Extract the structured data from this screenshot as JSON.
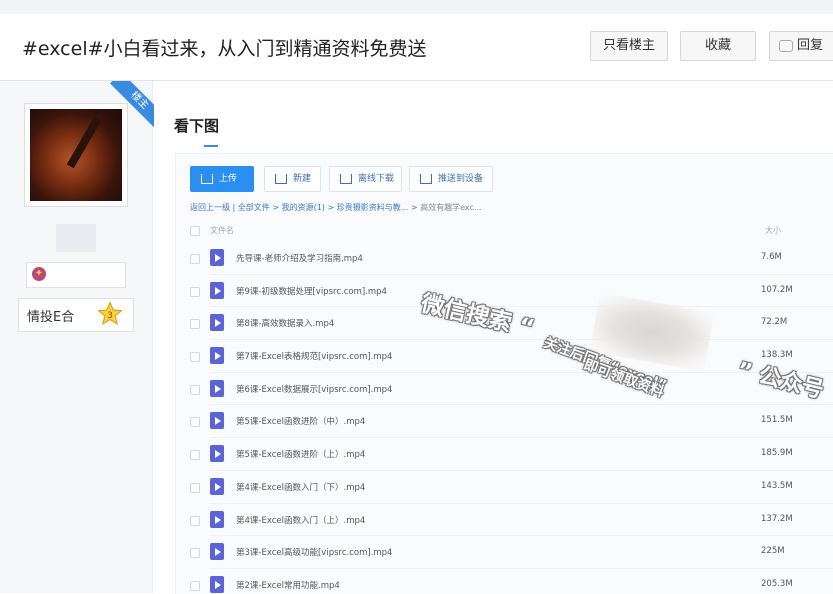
{
  "header": {
    "title": "#excel#小白看过来，从入门到精通资料免费送",
    "buttons": {
      "only_op": "只看楼主",
      "favorite": "收藏",
      "reply": "回复"
    }
  },
  "author": {
    "op_ribbon": "楼主",
    "badge_level": "3",
    "group_name": "情投E合"
  },
  "post": {
    "heading": "看下图",
    "screenshot": {
      "toolbar": {
        "upload": "上传",
        "new": "新建",
        "offline": "离线下载",
        "push": "推送到设备"
      },
      "breadcrumb": {
        "path": "返回上一级 | 全部文件 > 我的资源(1) > 珍贵摄影资料与教... >",
        "current": "高效有趣学exc..."
      },
      "columns": {
        "name": "文件名",
        "size": "大小"
      },
      "files": [
        {
          "name": "先导课-老师介绍及学习指南.mp4",
          "size": "7.6M"
        },
        {
          "name": "第9课-初级数据处理[vipsrc.com].mp4",
          "size": "107.2M"
        },
        {
          "name": "第8课-高效数据录入.mp4",
          "size": "72.2M"
        },
        {
          "name": "第7课-Excel表格规范[vipsrc.com].mp4",
          "size": "138.3M"
        },
        {
          "name": "第6课-Excel数据展示[vipsrc.com].mp4",
          "size": ""
        },
        {
          "name": "第5课-Excel函数进阶（中）.mp4",
          "size": "151.5M"
        },
        {
          "name": "第5课-Excel函数进阶（上）.mp4",
          "size": "185.9M"
        },
        {
          "name": "第4课-Excel函数入门（下）.mp4",
          "size": "143.5M"
        },
        {
          "name": "第4课-Excel函数入门（上）.mp4",
          "size": "137.2M"
        },
        {
          "name": "第3课-Excel高级功能[vipsrc.com].mp4",
          "size": "225M"
        },
        {
          "name": "第2课-Excel常用功能.mp4",
          "size": "205.3M"
        }
      ],
      "watermark": {
        "line1": "微信搜索 “",
        "line2": "关注后回复“excel”",
        "line3": "即可领取资料",
        "line4": "” 公众号"
      }
    }
  }
}
